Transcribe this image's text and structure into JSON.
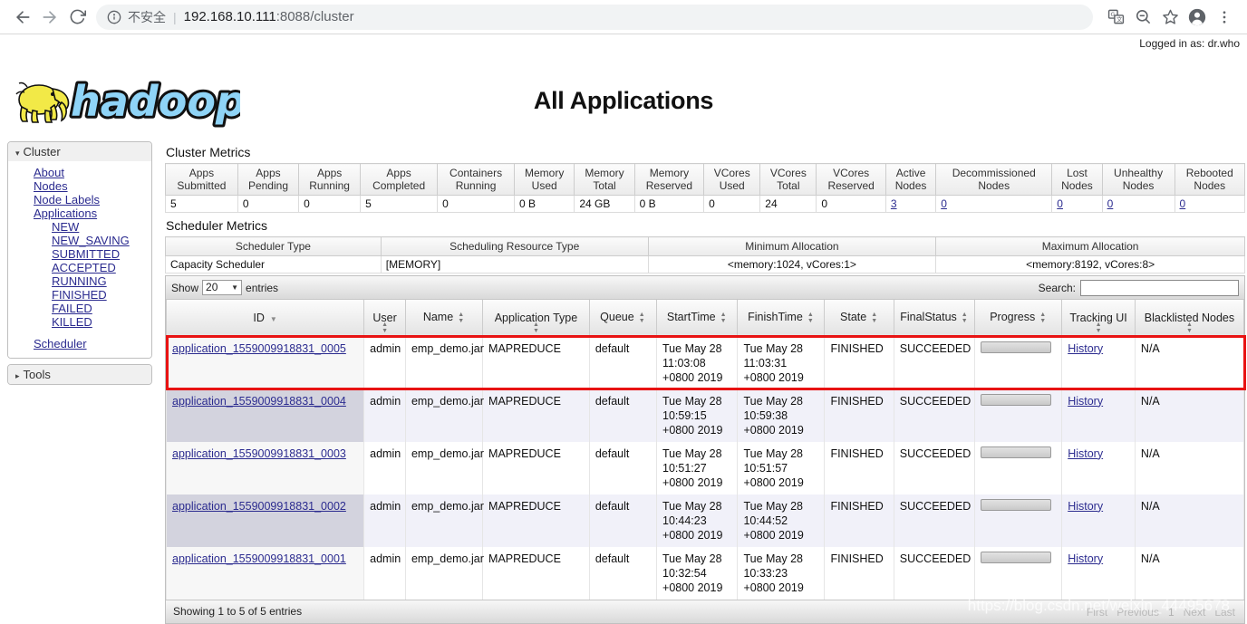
{
  "browser": {
    "back_icon": "back-arrow-icon",
    "forward_icon": "forward-arrow-icon",
    "reload_icon": "reload-icon",
    "info_icon": "info-circle-icon",
    "insecure_label": "不安全",
    "separator": "|",
    "url_host": "192.168.10.111",
    "url_rest": ":8088/cluster",
    "translate_icon": "translate-icon",
    "zoom_out_icon": "zoom-out-icon",
    "bookmark_icon": "star-icon",
    "profile_icon": "account-avatar-icon",
    "menu_icon": "three-dot-menu-icon"
  },
  "header": {
    "logged_in": "Logged in as: dr.who",
    "logo_alt": "hadoop-logo",
    "title": "All Applications"
  },
  "sidebar": {
    "cluster": {
      "label": "Cluster",
      "caret": "▾",
      "links": [
        {
          "label": "About",
          "name": "sidebar-link-about"
        },
        {
          "label": "Nodes",
          "name": "sidebar-link-nodes"
        },
        {
          "label": "Node Labels",
          "name": "sidebar-link-node-labels"
        },
        {
          "label": "Applications",
          "name": "sidebar-link-applications"
        }
      ],
      "states": [
        {
          "label": "NEW"
        },
        {
          "label": "NEW_SAVING"
        },
        {
          "label": "SUBMITTED"
        },
        {
          "label": "ACCEPTED"
        },
        {
          "label": "RUNNING"
        },
        {
          "label": "FINISHED"
        },
        {
          "label": "FAILED"
        },
        {
          "label": "KILLED"
        }
      ],
      "scheduler": "Scheduler"
    },
    "tools": {
      "label": "Tools",
      "caret": "▸"
    }
  },
  "cluster_metrics": {
    "title": "Cluster Metrics",
    "headers": [
      "Apps Submitted",
      "Apps Pending",
      "Apps Running",
      "Apps Completed",
      "Containers Running",
      "Memory Used",
      "Memory Total",
      "Memory Reserved",
      "VCores Used",
      "VCores Total",
      "VCores Reserved",
      "Active Nodes",
      "Decommissioned Nodes",
      "Lost Nodes",
      "Unhealthy Nodes",
      "Rebooted Nodes"
    ],
    "values": [
      "5",
      "0",
      "0",
      "5",
      "0",
      "0 B",
      "24 GB",
      "0 B",
      "0",
      "24",
      "0",
      "3",
      "0",
      "0",
      "0",
      "0"
    ],
    "link_flags": [
      false,
      false,
      false,
      false,
      false,
      false,
      false,
      false,
      false,
      false,
      false,
      true,
      true,
      true,
      true,
      true
    ]
  },
  "scheduler_metrics": {
    "title": "Scheduler Metrics",
    "headers": [
      "Scheduler Type",
      "Scheduling Resource Type",
      "Minimum Allocation",
      "Maximum Allocation"
    ],
    "values": [
      "Capacity Scheduler",
      "[MEMORY]",
      "<memory:1024, vCores:1>",
      "<memory:8192, vCores:8>"
    ]
  },
  "datatable": {
    "show_label": "Show",
    "page_length": "20",
    "entries_label": "entries",
    "search_label": "Search:",
    "search_value": "",
    "search_placeholder": "",
    "columns": [
      "ID",
      "User",
      "Name",
      "Application Type",
      "Queue",
      "StartTime",
      "FinishTime",
      "State",
      "FinalStatus",
      "Progress",
      "Tracking UI",
      "Blacklisted Nodes"
    ],
    "rows": [
      {
        "id": "application_1559009918831_0005",
        "user": "admin",
        "name": "emp_demo.jar",
        "type": "MAPREDUCE",
        "queue": "default",
        "start_time": "Tue May 28 11:03:08 +0800 2019",
        "finish_time": "Tue May 28 11:03:31 +0800 2019",
        "state": "FINISHED",
        "final_status": "SUCCEEDED",
        "progress": 0,
        "tracking_ui": "History",
        "blacklisted": "N/A",
        "highlighted": true
      },
      {
        "id": "application_1559009918831_0004",
        "user": "admin",
        "name": "emp_demo.jar",
        "type": "MAPREDUCE",
        "queue": "default",
        "start_time": "Tue May 28 10:59:15 +0800 2019",
        "finish_time": "Tue May 28 10:59:38 +0800 2019",
        "state": "FINISHED",
        "final_status": "SUCCEEDED",
        "progress": 0,
        "tracking_ui": "History",
        "blacklisted": "N/A",
        "highlighted": false
      },
      {
        "id": "application_1559009918831_0003",
        "user": "admin",
        "name": "emp_demo.jar",
        "type": "MAPREDUCE",
        "queue": "default",
        "start_time": "Tue May 28 10:51:27 +0800 2019",
        "finish_time": "Tue May 28 10:51:57 +0800 2019",
        "state": "FINISHED",
        "final_status": "SUCCEEDED",
        "progress": 0,
        "tracking_ui": "History",
        "blacklisted": "N/A",
        "highlighted": false
      },
      {
        "id": "application_1559009918831_0002",
        "user": "admin",
        "name": "emp_demo.jar",
        "type": "MAPREDUCE",
        "queue": "default",
        "start_time": "Tue May 28 10:44:23 +0800 2019",
        "finish_time": "Tue May 28 10:44:52 +0800 2019",
        "state": "FINISHED",
        "final_status": "SUCCEEDED",
        "progress": 0,
        "tracking_ui": "History",
        "blacklisted": "N/A",
        "highlighted": false
      },
      {
        "id": "application_1559009918831_0001",
        "user": "admin",
        "name": "emp_demo.jar",
        "type": "MAPREDUCE",
        "queue": "default",
        "start_time": "Tue May 28 10:32:54 +0800 2019",
        "finish_time": "Tue May 28 10:33:23 +0800 2019",
        "state": "FINISHED",
        "final_status": "SUCCEEDED",
        "progress": 0,
        "tracking_ui": "History",
        "blacklisted": "N/A",
        "highlighted": false
      }
    ],
    "info": "Showing 1 to 5 of 5 entries",
    "pagination": [
      "First",
      "Previous",
      "1",
      "Next",
      "Last"
    ],
    "watermark": "https://blog.csdn.net/weixin_44495678"
  },
  "colors": {
    "highlight_box": "#e81313",
    "link": "#2b2b8f",
    "row_even": "#f1f1f9",
    "id_cell_even": "#d3d3de",
    "logo_yellow": "#f2e947",
    "logo_blue": "#8fd4f7"
  }
}
